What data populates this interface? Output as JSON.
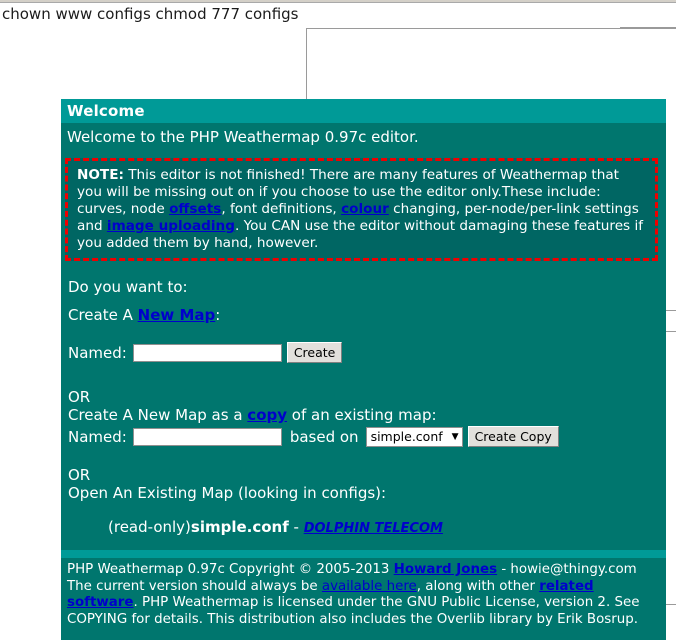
{
  "shell": {
    "command_line": "chown www configs chmod 777 configs"
  },
  "panel": {
    "header_title": "Welcome",
    "intro": "Welcome to the PHP Weathermap 0.97c editor.",
    "note": {
      "label": "NOTE:",
      "part1": " This editor is not finished! There are many features of Weathermap that you will be missing out on if you choose to use the editor only.These include: curves, node ",
      "link_offsets": "offsets",
      "part2": ", font definitions, ",
      "link_colour": "colour",
      "part3": " changing, per-node/per-link settings and ",
      "link_image_uploading": "image uploading",
      "part4": ". You CAN use the editor without damaging these features if you added them by hand, however."
    },
    "prompt": "Do you want to:",
    "create_new": {
      "prefix": "Create A ",
      "link": "New Map",
      "suffix": ":",
      "named_label": "Named:",
      "name_value": "",
      "name_placeholder": "",
      "create_button": "Create"
    },
    "or_1": "OR",
    "create_copy": {
      "prefix": "Create A New Map as a ",
      "link": "copy",
      "suffix": " of an existing map:",
      "named_label": "Named:",
      "name_value": "",
      "name_placeholder": "",
      "based_on_label": "based on",
      "selected_option": "simple.conf",
      "options": [
        "simple.conf"
      ],
      "create_copy_button": "Create Copy"
    },
    "or_2": "OR",
    "open_existing": {
      "heading": "Open An Existing Map (looking in configs):",
      "entries": [
        {
          "readonly_tag": "(read-only)",
          "filename": "simple.conf",
          "separator": " - ",
          "title_link": "DOLPHIN TELECOM"
        }
      ]
    },
    "footer": {
      "line1_a": "PHP Weathermap 0.97c Copyright © 2005-2013 ",
      "line1_link": "Howard Jones",
      "line1_b": " - howie@thingy.com",
      "line2_a": "The current version should always be ",
      "line2_link": "available here",
      "line2_b": ", along with other ",
      "line3_link": "related software",
      "line3_b": ". PHP Weathermap is licensed under the GNU Public License, version 2. See COPYING for details. This distribution also includes the Overlib library by Erik Bosrup."
    }
  },
  "colors": {
    "panel_body": "#00766e",
    "panel_header": "#009a97",
    "note_bg": "#006663",
    "note_border": "#ee0000",
    "link": "#0000cc",
    "text": "#ffffff"
  }
}
